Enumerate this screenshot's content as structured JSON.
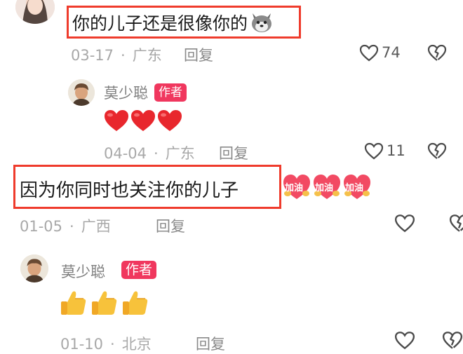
{
  "comments": [
    {
      "text": "你的儿子还是很像你的",
      "date": "03-17",
      "location": "广东",
      "reply_label": "回复",
      "likes": "74",
      "emoji": "dog-face-emoji"
    },
    {
      "author": "莫少聪",
      "badge": "作者",
      "emojis": [
        "red-heart-emoji",
        "red-heart-emoji",
        "red-heart-emoji"
      ],
      "date": "04-04",
      "location": "广东",
      "reply_label": "回复",
      "likes": "11"
    },
    {
      "text": "因为你同时也关注你的儿子",
      "stickers": [
        "加油",
        "加油",
        "加油"
      ],
      "date": "01-05",
      "location": "广西",
      "reply_label": "回复"
    },
    {
      "author": "莫少聪",
      "badge": "作者",
      "emojis": [
        "thumbs-up-emoji",
        "thumbs-up-emoji",
        "thumbs-up-emoji"
      ],
      "date": "01-10",
      "location": "北京",
      "reply_label": "回复"
    }
  ],
  "colors": {
    "highlight_box": "#ef3b2c",
    "author_badge": "#f0375e",
    "meta_text": "#a8a8a8"
  }
}
